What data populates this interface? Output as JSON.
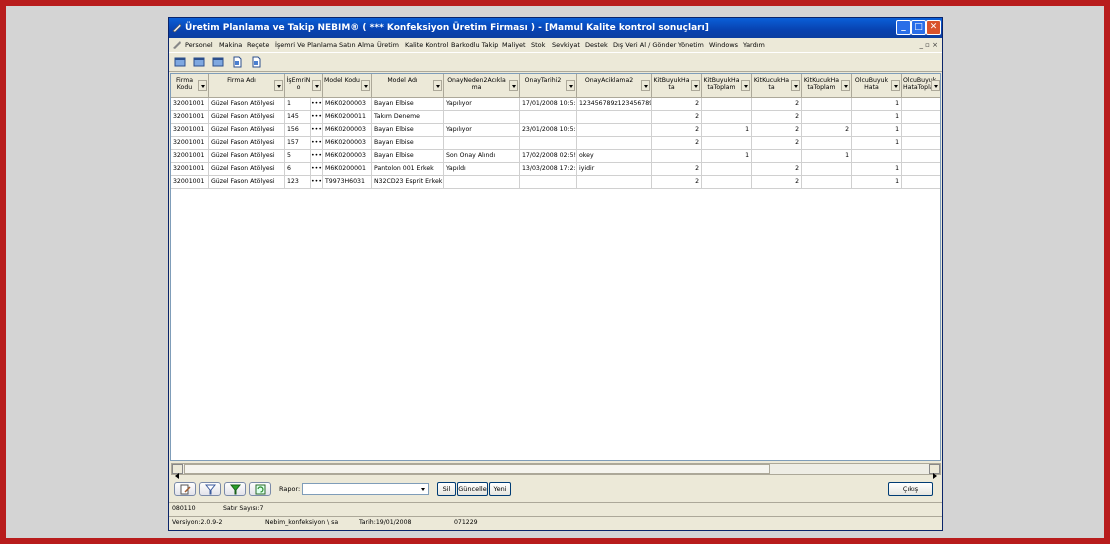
{
  "window": {
    "title": "Üretim Planlama ve Takip    NEBIM®   ( *** Konfeksiyon Üretim Firması ) - [Mamul Kalite kontrol sonuçları]",
    "controls": [
      "_",
      "□",
      "✕"
    ]
  },
  "menu": {
    "items": [
      "Personel",
      "Makina",
      "Reçete",
      "İşemri Ve Planlama",
      "Satın Alma",
      "Üretim",
      "Kalite Kontrol",
      "Barkodlu Takip",
      "Maliyet",
      "Stok",
      "Sevkiyat",
      "Destek",
      "Dış Veri Al / Gönder",
      "Yönetim",
      "Windows",
      "Yardım"
    ],
    "mdi_controls": "_  ▫  ×"
  },
  "toolbar": {
    "icons": [
      "new-icon",
      "open-icon",
      "save-icon",
      "print-icon",
      "preview-icon"
    ]
  },
  "grid": {
    "columns": [
      {
        "label": "Firma Kodu"
      },
      {
        "label": "Firma Adı"
      },
      {
        "label": "İşEmriN o"
      },
      {
        "label": ""
      },
      {
        "label": "Model Kodu"
      },
      {
        "label": "Model Adı"
      },
      {
        "label": "OnayNeden2Acıkla ma"
      },
      {
        "label": "OnayTarihi2"
      },
      {
        "label": "OnayAciklama2"
      },
      {
        "label": "KitBuyukHa ta"
      },
      {
        "label": "KitBuyukHa taToplam"
      },
      {
        "label": "KitKucukHa ta"
      },
      {
        "label": "KitKucukHa taToplam"
      },
      {
        "label": "OlcuBuyuk Hata"
      },
      {
        "label": "OlcuBuyuk HataToplam"
      }
    ],
    "rows": [
      [
        "32001001",
        "Güzel Fason Atölyesi",
        "1",
        "•••",
        "M6K0200003",
        "Bayan Elbise",
        "Yapılıyor",
        "17/01/2008 10:5:",
        "123456789z123456789:",
        "2",
        "",
        "2",
        "",
        "1",
        ""
      ],
      [
        "32001001",
        "Güzel Fason Atölyesi",
        "145",
        "•••",
        "M6K0200011",
        "Takım Deneme",
        "",
        "",
        "",
        "2",
        "",
        "2",
        "",
        "1",
        ""
      ],
      [
        "32001001",
        "Güzel Fason Atölyesi",
        "156",
        "•••",
        "M6K0200003",
        "Bayan Elbise",
        "Yapılıyor",
        "23/01/2008 10:5:",
        "",
        "2",
        "1",
        "2",
        "2",
        "1",
        ""
      ],
      [
        "32001001",
        "Güzel Fason Atölyesi",
        "157",
        "•••",
        "M6K0200003",
        "Bayan Elbise",
        "",
        "",
        "",
        "2",
        "",
        "2",
        "",
        "1",
        ""
      ],
      [
        "32001001",
        "Güzel Fason Atölyesi",
        "5",
        "•••",
        "M6K0200003",
        "Bayan Elbise",
        "Son Onay Alındı",
        "17/02/2008 02:5!",
        "okey",
        "",
        "1",
        "",
        "1",
        "",
        ""
      ],
      [
        "32001001",
        "Güzel Fason Atölyesi",
        "6",
        "•••",
        "M6K0200001",
        "Pantolon 001 Erkek",
        "Yapıldı",
        "13/03/2008 17:2:",
        "iyidir",
        "2",
        "",
        "2",
        "",
        "1",
        ""
      ],
      [
        "32001001",
        "Güzel Fason Atölyesi",
        "123",
        "•••",
        "T9973H6031",
        "N32CD23 Esprit Erkek F",
        "",
        "",
        "",
        "2",
        "",
        "2",
        "",
        "1",
        ""
      ]
    ]
  },
  "bottom": {
    "rapor_label": "Rapor:",
    "rapor_value": "",
    "sil": "Sil",
    "guncelle": "Güncelle",
    "yeni": "Yeni",
    "cikis": "Çıkış"
  },
  "status1": {
    "code": "080110",
    "rows": "Satır Sayısı:7"
  },
  "status2": {
    "version": "Versiyon:2.0.9-2",
    "db": "Nebim_konfeksiyon \\ sa",
    "date": "Tarih:19/01/2008",
    "num": "071229"
  },
  "colors": {
    "titlebar": "#0842b0",
    "frame": "#b81c1c"
  }
}
